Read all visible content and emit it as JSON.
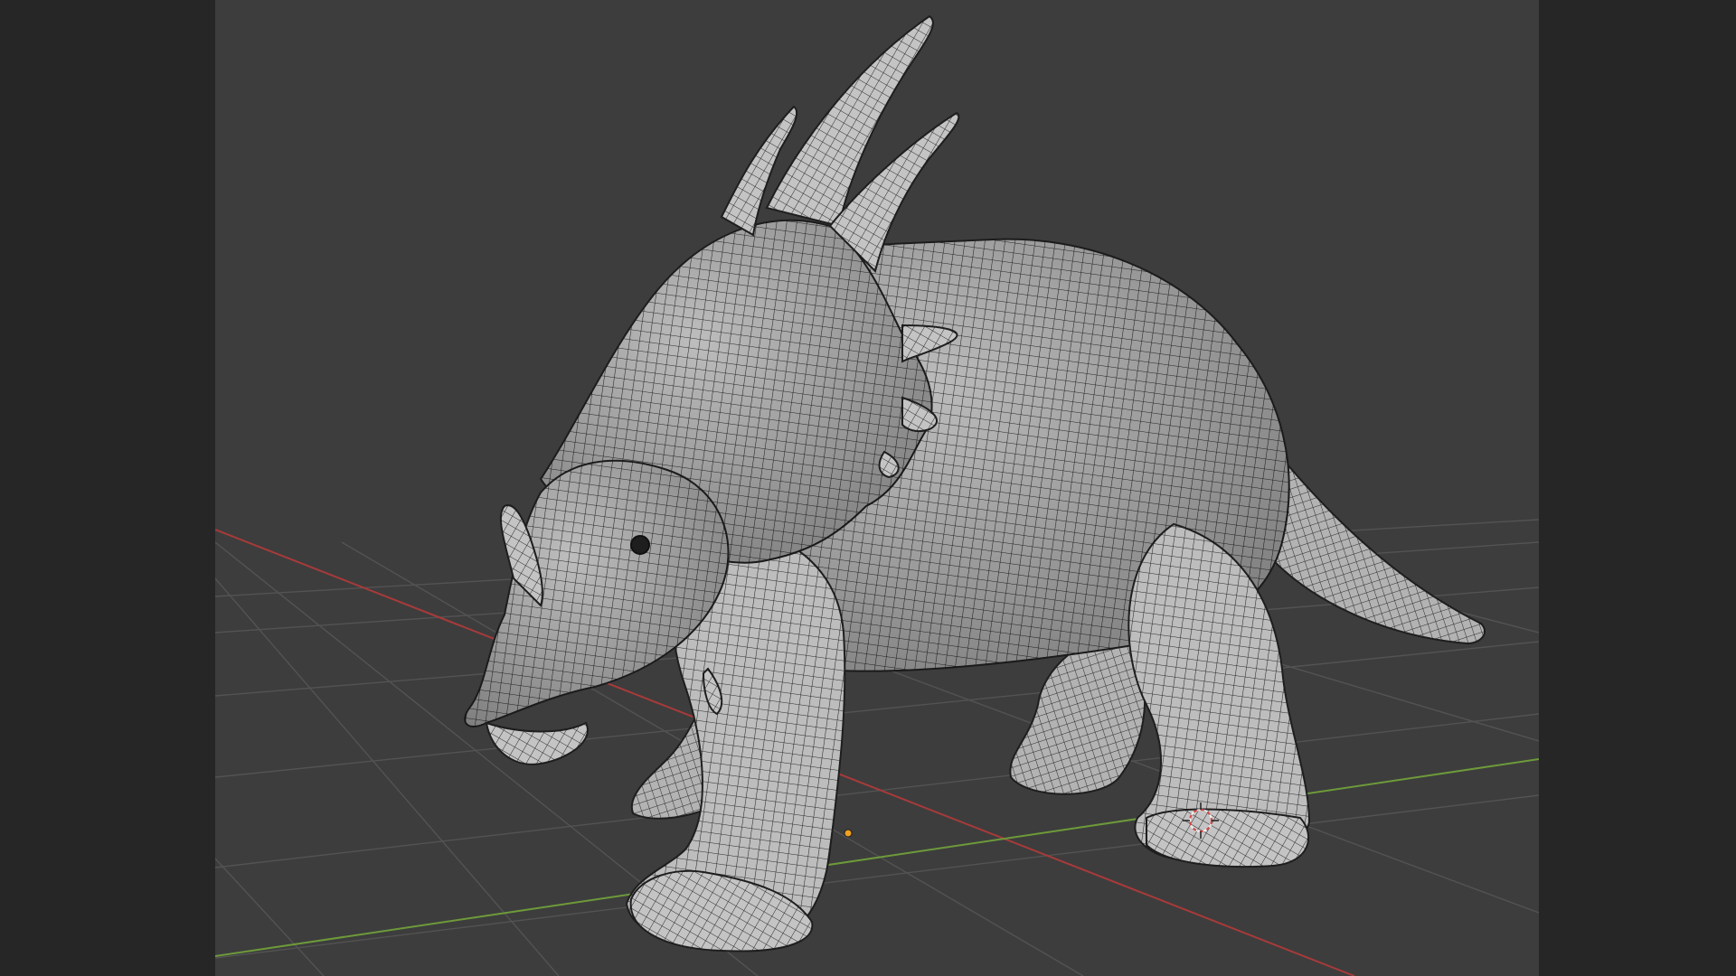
{
  "app": {
    "view": "3D Viewport",
    "shading": "solid-wireframe"
  },
  "colors": {
    "viewport_bg": "#3d3d3d",
    "letterbox": "#262626",
    "grid_line": "#535353",
    "x_axis": "#a83a3a",
    "y_axis": "#6d9a3a",
    "mesh_fill": "#b9b9b9",
    "mesh_shadow": "#8a8a8a",
    "mesh_wire": "#2a2a2a",
    "origin_point": "#f0a020",
    "cursor_3d": "#d44545"
  },
  "scene": {
    "object": "styracosaurus-mesh",
    "icons": [
      "3d-cursor-icon",
      "origin-point-icon"
    ]
  }
}
